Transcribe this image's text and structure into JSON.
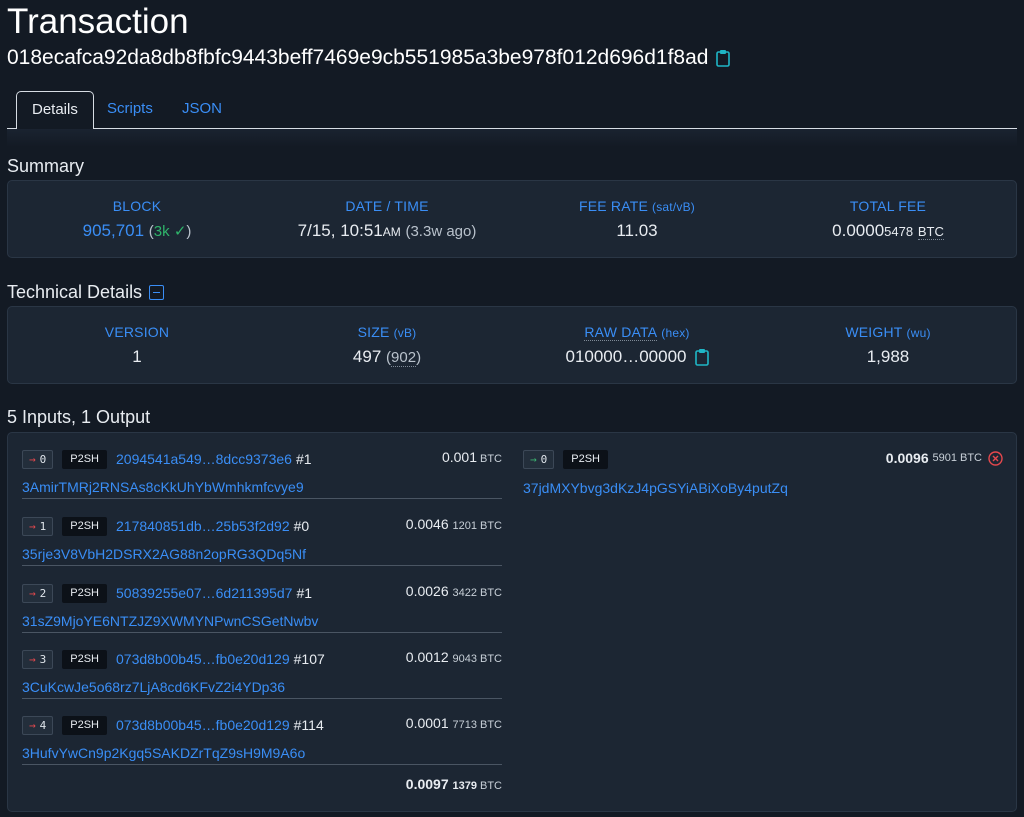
{
  "title": "Transaction",
  "txid": "018ecafca92da8db8fbfc9443beff7469e9cb551985a3be978f012d696d1f8ad",
  "tabs": [
    {
      "label": "Details"
    },
    {
      "label": "Scripts"
    },
    {
      "label": "JSON"
    }
  ],
  "summary": {
    "title": "Summary",
    "block": {
      "label": "BLOCK",
      "value": "905,701",
      "confirm_open": "(",
      "confirmations": "3k",
      "check": "✓",
      "confirm_close": ")"
    },
    "datetime": {
      "label": "DATE / TIME",
      "date": "7/15, 10:51",
      "ampm": "AM",
      "ago": "(3.3w ago)"
    },
    "fee_rate": {
      "label": "FEE RATE",
      "unit": "(sat/vB)",
      "value": "11.03"
    },
    "total_fee": {
      "label": "TOTAL FEE",
      "main": "0.0000",
      "tail": "5478",
      "unit": "BTC"
    }
  },
  "technical": {
    "title": "Technical Details",
    "version": {
      "label": "VERSION",
      "value": "1"
    },
    "size": {
      "label": "SIZE",
      "unit": "(vB)",
      "value": "497",
      "paren_open": "(",
      "secondary": "902",
      "paren_close": ")"
    },
    "raw_data": {
      "label": "RAW DATA",
      "unit": "(hex)",
      "value": "010000…00000"
    },
    "weight": {
      "label": "WEIGHT",
      "unit": "(wu)",
      "value": "1,988"
    }
  },
  "io": {
    "title": "5 Inputs, 1 Output",
    "inputs": [
      {
        "index": "0",
        "type": "P2SH",
        "txref": "2094541a549…8dcc9373e6",
        "vout": "#1",
        "amount_main": "0.001",
        "amount_tail": "",
        "unit": "BTC",
        "address": "3AmirTMRj2RNSAs8cKkUhYbWmhkmfcvye9"
      },
      {
        "index": "1",
        "type": "P2SH",
        "txref": "217840851db…25b53f2d92",
        "vout": "#0",
        "amount_main": "0.0046",
        "amount_tail": "1201",
        "unit": "BTC",
        "address": "35rje3V8VbH2DSRX2AG88n2opRG3QDq5Nf"
      },
      {
        "index": "2",
        "type": "P2SH",
        "txref": "50839255e07…6d211395d7",
        "vout": "#1",
        "amount_main": "0.0026",
        "amount_tail": "3422",
        "unit": "BTC",
        "address": "31sZ9MjoYE6NTZJZ9XWMYNPwnCSGetNwbv"
      },
      {
        "index": "3",
        "type": "P2SH",
        "txref": "073d8b00b45…fb0e20d129",
        "vout": "#107",
        "amount_main": "0.0012",
        "amount_tail": "9043",
        "unit": "BTC",
        "address": "3CuKcwJe5o68rz7LjA8cd6KFvZ2i4YDp36"
      },
      {
        "index": "4",
        "type": "P2SH",
        "txref": "073d8b00b45…fb0e20d129",
        "vout": "#114",
        "amount_main": "0.0001",
        "amount_tail": "7713",
        "unit": "BTC",
        "address": "3HufvYwCn9p2Kgq5SAKDZrTqZ9sH9M9A6o"
      }
    ],
    "total_in": {
      "main": "0.0097",
      "tail": "1379",
      "unit": "BTC"
    },
    "outputs": [
      {
        "index": "0",
        "type": "P2SH",
        "amount_main": "0.0096",
        "amount_tail": "5901",
        "unit": "BTC",
        "address": "37jdMXYbvg3dKzJ4pGSYiABiXoBy4putZq"
      }
    ]
  },
  "colors": {
    "accent": "#3a8ef6",
    "background": "#131a24",
    "panel": "#1c2633",
    "confirm": "#2fb36a",
    "spent": "#e5484d"
  },
  "icons": [
    "copy-icon",
    "collapse-icon",
    "arrow-right-icon",
    "spent-x-icon",
    "checkmark-icon"
  ]
}
